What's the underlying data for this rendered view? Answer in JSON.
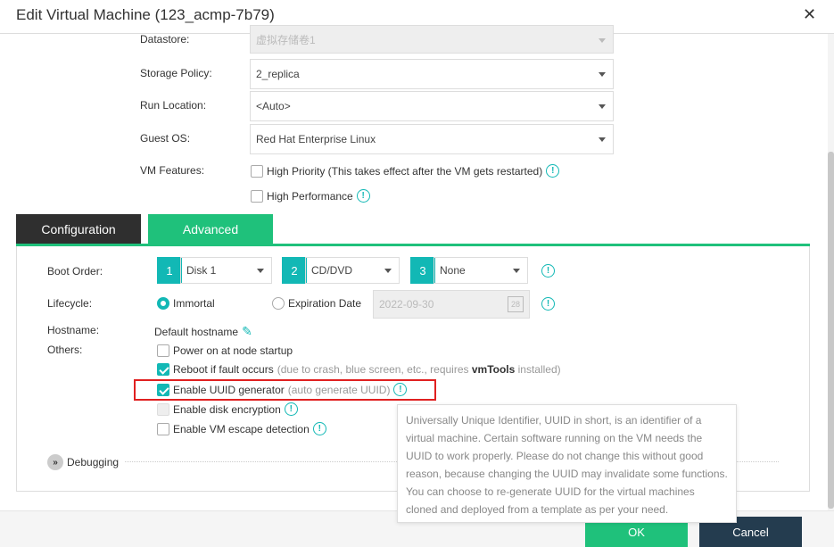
{
  "dialog": {
    "title": "Edit Virtual Machine (123_acmp-7b79)"
  },
  "form": {
    "datastore": {
      "label": "Datastore:",
      "value": "虚拟存储卷1"
    },
    "storage_policy": {
      "label": "Storage Policy:",
      "value": "2_replica"
    },
    "run_location": {
      "label": "Run Location:",
      "value": "<Auto>"
    },
    "guest_os": {
      "label": "Guest OS:",
      "value": "Red Hat Enterprise Linux"
    },
    "vm_features": {
      "label": "VM Features:",
      "high_priority": "High Priority (This takes effect after the VM gets restarted)",
      "high_performance": "High Performance"
    }
  },
  "tabs": [
    {
      "label": "Configuration"
    },
    {
      "label": "Advanced"
    }
  ],
  "advanced": {
    "boot_order": {
      "label": "Boot Order:",
      "items": [
        {
          "num": "1",
          "value": "Disk 1"
        },
        {
          "num": "2",
          "value": "CD/DVD"
        },
        {
          "num": "3",
          "value": "None"
        }
      ]
    },
    "lifecycle": {
      "label": "Lifecycle:",
      "immortal": "Immortal",
      "expiration": "Expiration Date",
      "date": "2022-09-30",
      "cal_day": "28"
    },
    "hostname": {
      "label": "Hostname:",
      "value": "Default hostname"
    },
    "others": {
      "label": "Others:",
      "power_on": "Power on at node startup",
      "reboot": "Reboot if fault occurs",
      "reboot_note1": "(due to crash, blue screen, etc., requires ",
      "reboot_bold": "vmTools",
      "reboot_note2": " installed)",
      "uuid": "Enable UUID generator",
      "uuid_note": "(auto generate UUID)",
      "disk_enc": "Enable disk encryption",
      "escape": "Enable VM escape detection"
    },
    "debugging": "Debugging"
  },
  "tooltip": "Universally Unique Identifier, UUID in short, is an identifier of a virtual machine. Certain software running on the VM needs the UUID to work properly. Please do not change this without good reason, because changing the UUID may invalidate some functions. You can choose to re-generate UUID for the virtual machines cloned and deployed from a template as per your need.",
  "footer": {
    "ok": "OK",
    "cancel": "Cancel"
  },
  "info_glyph": "!"
}
